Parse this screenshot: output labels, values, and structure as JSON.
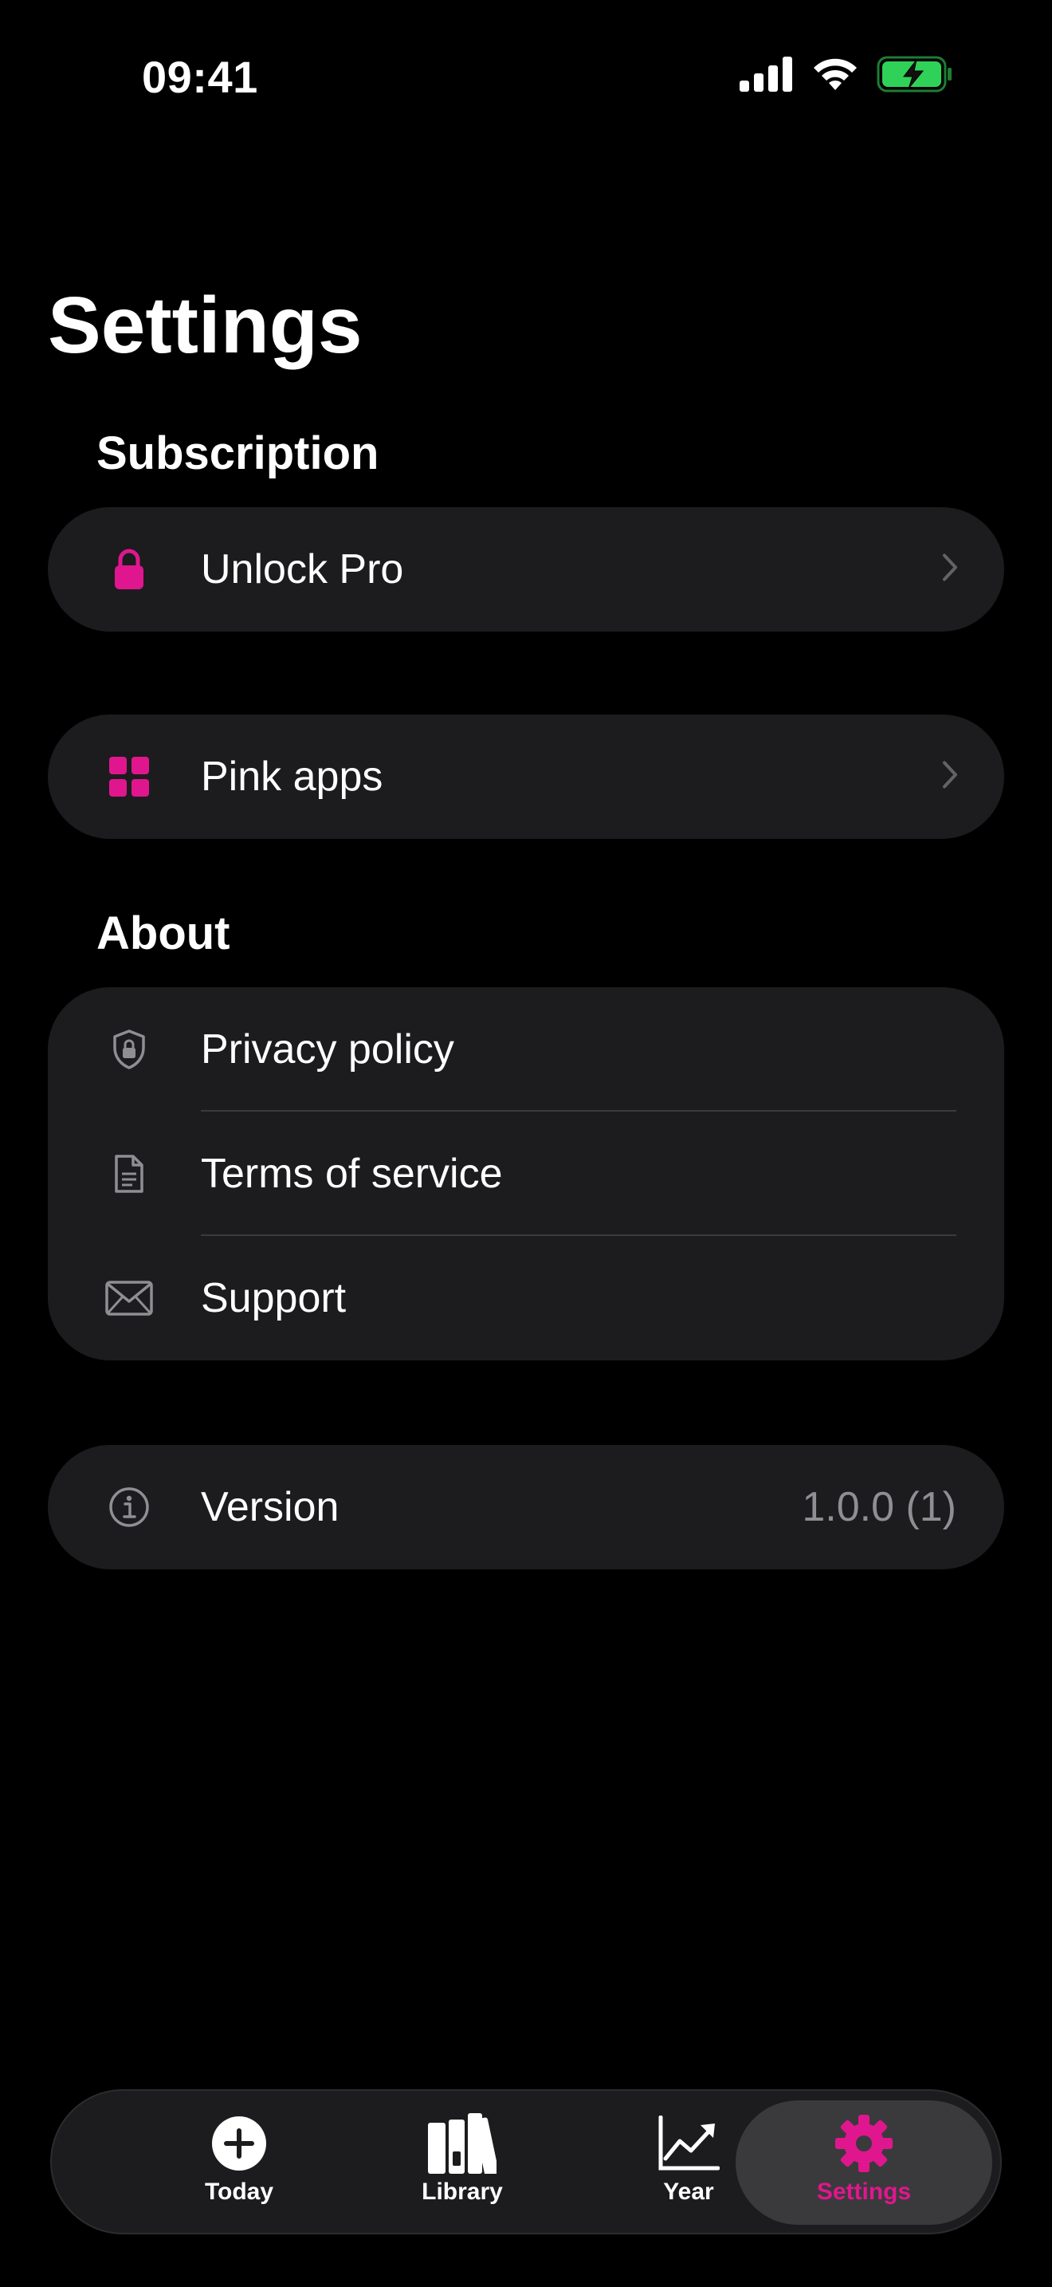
{
  "status_bar": {
    "time": "09:41",
    "icons": [
      "cellular-signal-icon",
      "wifi-icon",
      "battery-charging-icon"
    ]
  },
  "page_title": "Settings",
  "accent_color": "#e0168e",
  "sections": {
    "subscription": {
      "header": "Subscription",
      "unlock_pro": {
        "label": "Unlock Pro",
        "icon": "lock-icon"
      }
    },
    "pink_apps": {
      "label": "Pink apps",
      "icon": "grid-icon"
    },
    "about": {
      "header": "About",
      "items": [
        {
          "label": "Privacy policy",
          "icon": "shield-lock-icon"
        },
        {
          "label": "Terms of service",
          "icon": "document-icon"
        },
        {
          "label": "Support",
          "icon": "envelope-icon"
        }
      ]
    },
    "version": {
      "label": "Version",
      "value": "1.0.0 (1)",
      "icon": "info-icon"
    }
  },
  "tab_bar": {
    "tabs": [
      {
        "label": "Today",
        "icon": "plus-circle-icon",
        "selected": false
      },
      {
        "label": "Library",
        "icon": "books-icon",
        "selected": false
      },
      {
        "label": "Year",
        "icon": "chart-line-icon",
        "selected": false
      },
      {
        "label": "Settings",
        "icon": "gear-icon",
        "selected": true
      }
    ]
  }
}
